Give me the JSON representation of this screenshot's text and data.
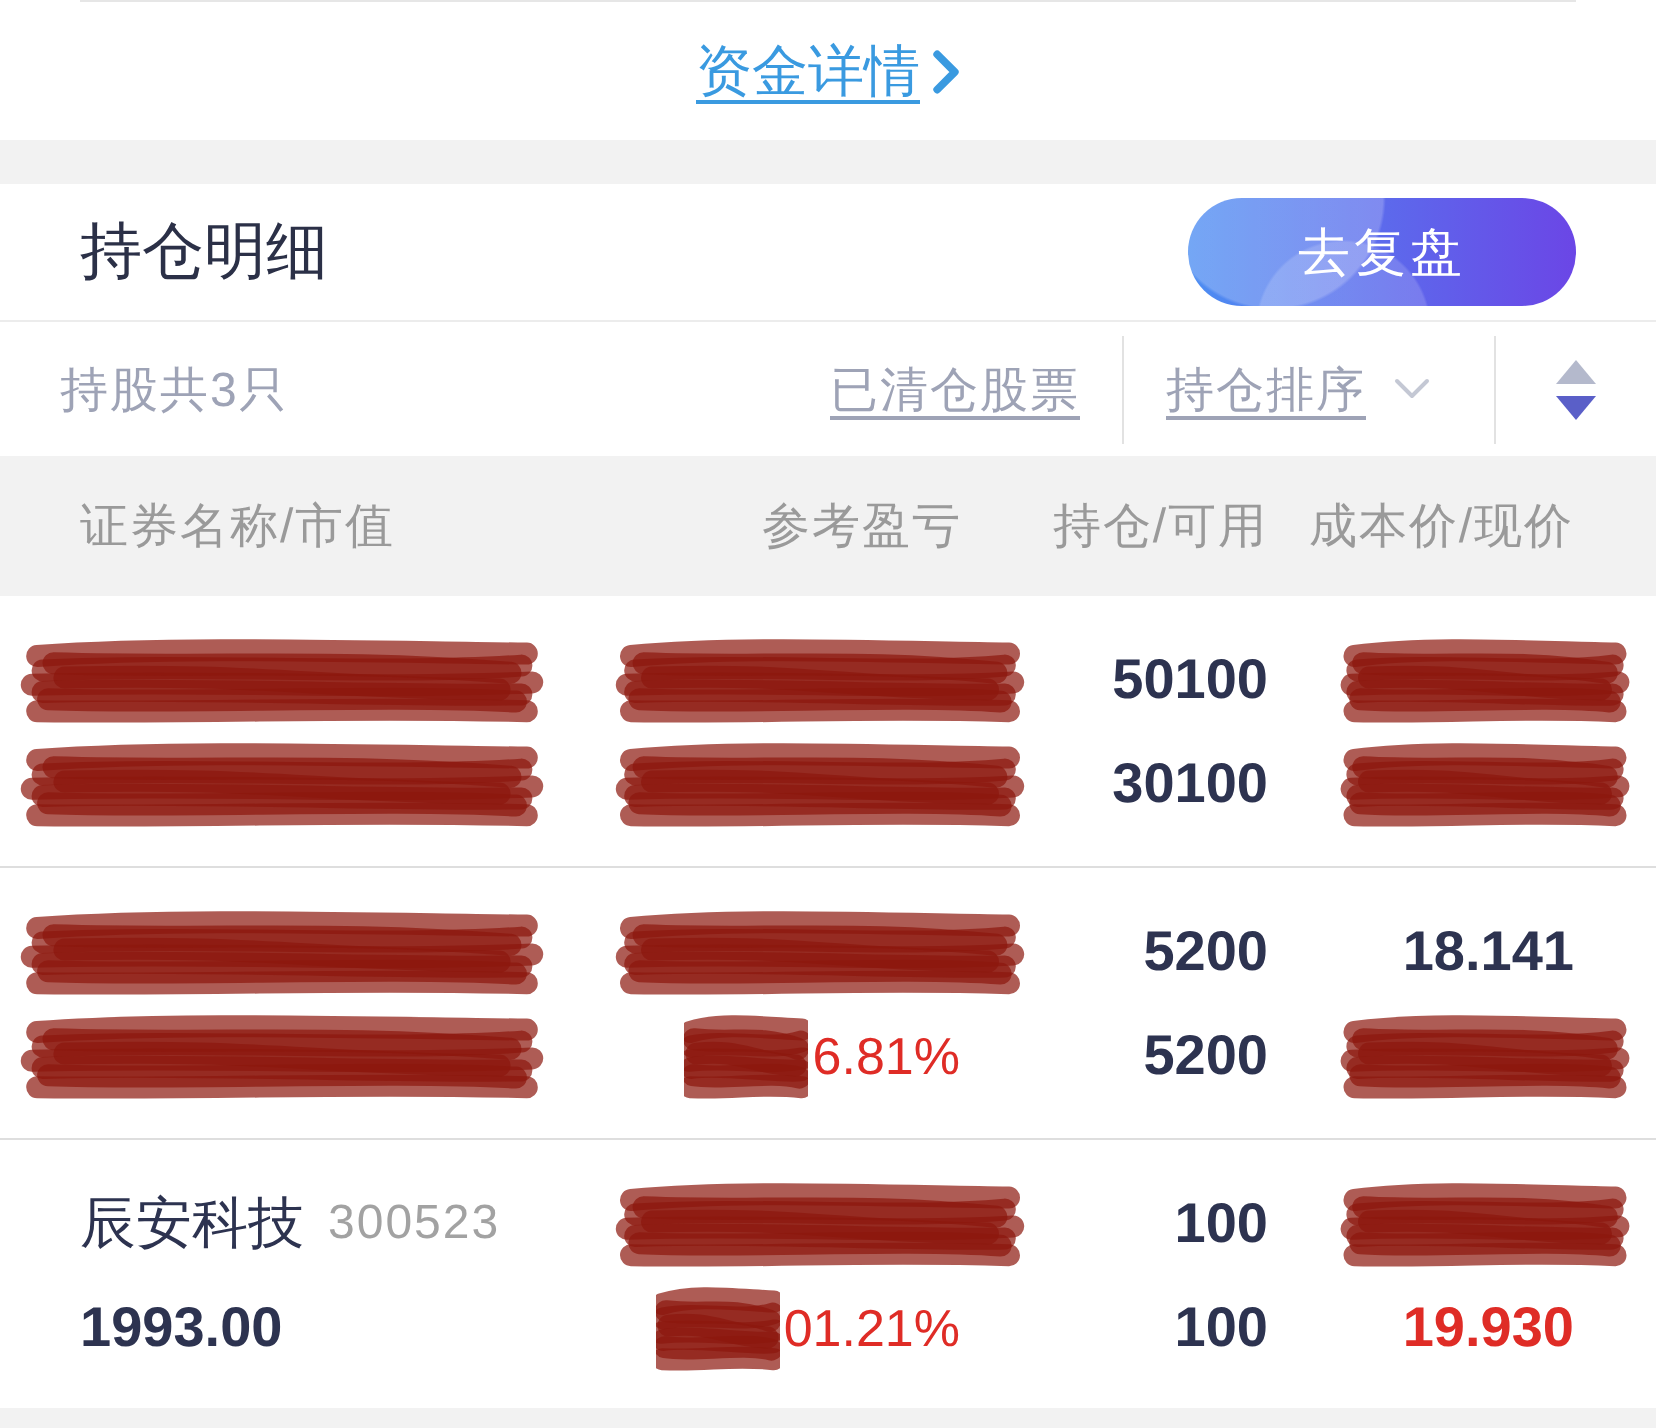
{
  "funds_link": {
    "label": "资金详情"
  },
  "holdings_header": {
    "title": "持仓明细",
    "review_button": "去复盘"
  },
  "filter_bar": {
    "count_label": "持股共3只",
    "cleared_link": "已清仓股票",
    "sort_dropdown": "持仓排序",
    "descending": true
  },
  "table": {
    "columns": [
      "证券名称/市值",
      "参考盈亏",
      "持仓/可用",
      "成本价/现价"
    ],
    "rows": [
      {
        "name": {
          "redacted": true
        },
        "market_value": {
          "redacted": true
        },
        "pnl": {
          "redacted": true
        },
        "pnl_ratio": {
          "redacted": true
        },
        "position": {
          "text": "50100",
          "redacted": false
        },
        "available": {
          "text": "30100",
          "redacted": false
        },
        "cost": {
          "redacted": true
        },
        "price": {
          "redacted": true
        }
      },
      {
        "name": {
          "redacted": true
        },
        "market_value": {
          "redacted": true
        },
        "pnl": {
          "redacted": true
        },
        "pnl_ratio": {
          "text": "6.81%",
          "redacted": true,
          "color": "#df2c26"
        },
        "position": {
          "text": "5200",
          "redacted": false
        },
        "available": {
          "text": "5200",
          "redacted": false
        },
        "cost": {
          "text": "18.141",
          "redacted": false
        },
        "price": {
          "redacted": true
        }
      },
      {
        "name": {
          "text": "辰安科技",
          "redacted": false
        },
        "code": {
          "text": "300523",
          "redacted": false
        },
        "market_value": {
          "text": "1993.00",
          "redacted": false
        },
        "pnl": {
          "redacted": true
        },
        "pnl_ratio": {
          "text": "01.21%",
          "redacted": true,
          "color": "#df2c26"
        },
        "position": {
          "text": "100",
          "redacted": false
        },
        "available": {
          "text": "100",
          "redacted": false
        },
        "cost": {
          "redacted": true
        },
        "price": {
          "text": "19.930",
          "redacted": false,
          "color": "#df2c26"
        }
      }
    ]
  }
}
